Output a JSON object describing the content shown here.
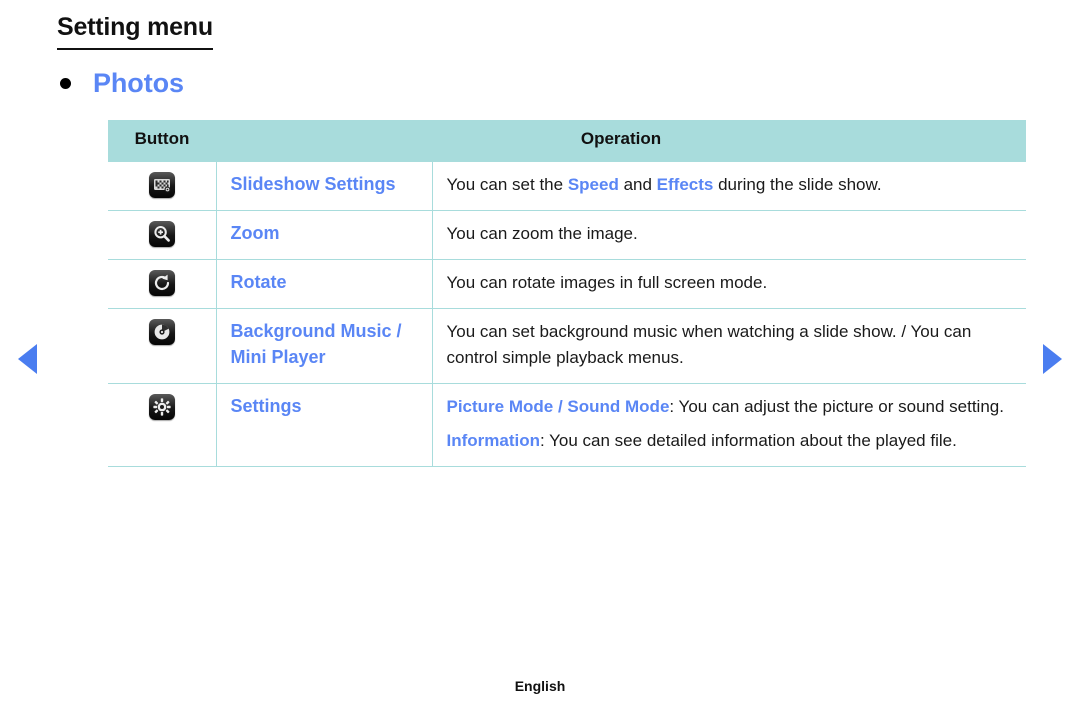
{
  "page": {
    "title": "Setting menu",
    "section_bullet_label": "Photos",
    "footer_language": "English"
  },
  "nav": {
    "prev_label": "Previous page",
    "next_label": "Next page"
  },
  "colors": {
    "header_bg": "#a8dcdc",
    "border": "#a8dcdc",
    "accent_blue": "#5a86f5",
    "arrow_blue": "#4a7df0",
    "text": "#1a1a1a"
  },
  "table": {
    "headers": {
      "button": "Button",
      "operation": "Operation"
    },
    "rows": [
      {
        "icon": "slideshow-settings-icon",
        "name": "Slideshow Settings",
        "description_segments": [
          [
            {
              "text": "You can set the ",
              "style": "plain"
            },
            {
              "text": "Speed",
              "style": "highlight"
            },
            {
              "text": " and ",
              "style": "plain"
            },
            {
              "text": "Effects",
              "style": "highlight"
            },
            {
              "text": " during the slide show.",
              "style": "plain"
            }
          ]
        ]
      },
      {
        "icon": "zoom-in-icon",
        "name": "Zoom",
        "description_segments": [
          [
            {
              "text": "You can zoom the image.",
              "style": "plain"
            }
          ]
        ]
      },
      {
        "icon": "rotate-icon",
        "name": "Rotate",
        "description_segments": [
          [
            {
              "text": "You can rotate images in full screen mode.",
              "style": "plain"
            }
          ]
        ]
      },
      {
        "icon": "background-music-icon",
        "name": "Background Music / Mini Player",
        "description_segments": [
          [
            {
              "text": "You can set background music when watching a slide show. / You can control simple playback menus.",
              "style": "plain"
            }
          ]
        ]
      },
      {
        "icon": "settings-gear-icon",
        "name": "Settings",
        "description_segments": [
          [
            {
              "text": "Picture Mode / Sound Mode",
              "style": "highlight"
            },
            {
              "text": ": You can adjust the picture or sound setting.",
              "style": "plain"
            }
          ],
          [
            {
              "text": "Information",
              "style": "highlight"
            },
            {
              "text": ": You can see detailed information about the played file.",
              "style": "plain"
            }
          ]
        ]
      }
    ]
  }
}
